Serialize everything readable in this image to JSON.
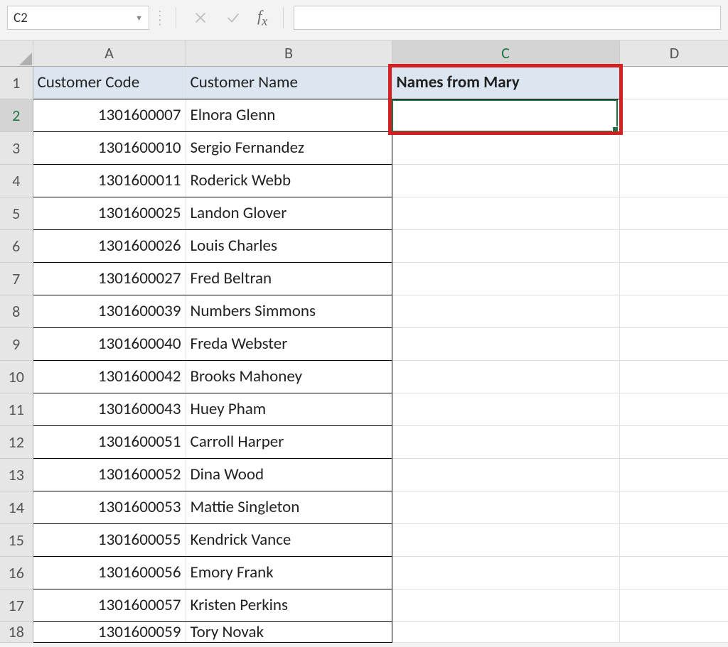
{
  "formula_bar": {
    "name_box": "C2",
    "formula": ""
  },
  "columns": {
    "A": "A",
    "B": "B",
    "C": "C",
    "D": "D"
  },
  "headers": {
    "A": "Customer Code",
    "B": "Customer Name",
    "C": "Names from Mary"
  },
  "rows": [
    {
      "n": "1"
    },
    {
      "n": "2",
      "code": "1301600007",
      "name": "Elnora Glenn"
    },
    {
      "n": "3",
      "code": "1301600010",
      "name": "Sergio Fernandez"
    },
    {
      "n": "4",
      "code": "1301600011",
      "name": "Roderick Webb"
    },
    {
      "n": "5",
      "code": "1301600025",
      "name": "Landon Glover"
    },
    {
      "n": "6",
      "code": "1301600026",
      "name": "Louis Charles"
    },
    {
      "n": "7",
      "code": "1301600027",
      "name": "Fred Beltran"
    },
    {
      "n": "8",
      "code": "1301600039",
      "name": "Numbers Simmons"
    },
    {
      "n": "9",
      "code": "1301600040",
      "name": "Freda Webster"
    },
    {
      "n": "10",
      "code": "1301600042",
      "name": "Brooks Mahoney"
    },
    {
      "n": "11",
      "code": "1301600043",
      "name": "Huey Pham"
    },
    {
      "n": "12",
      "code": "1301600051",
      "name": "Carroll Harper"
    },
    {
      "n": "13",
      "code": "1301600052",
      "name": "Dina Wood"
    },
    {
      "n": "14",
      "code": "1301600053",
      "name": "Mattie Singleton"
    },
    {
      "n": "15",
      "code": "1301600055",
      "name": "Kendrick Vance"
    },
    {
      "n": "16",
      "code": "1301600056",
      "name": "Emory Frank"
    },
    {
      "n": "17",
      "code": "1301600057",
      "name": "Kristen Perkins"
    },
    {
      "n": "18",
      "code": "1301600059",
      "name": "Tory Novak"
    }
  ],
  "selection": {
    "cell": "C2"
  }
}
